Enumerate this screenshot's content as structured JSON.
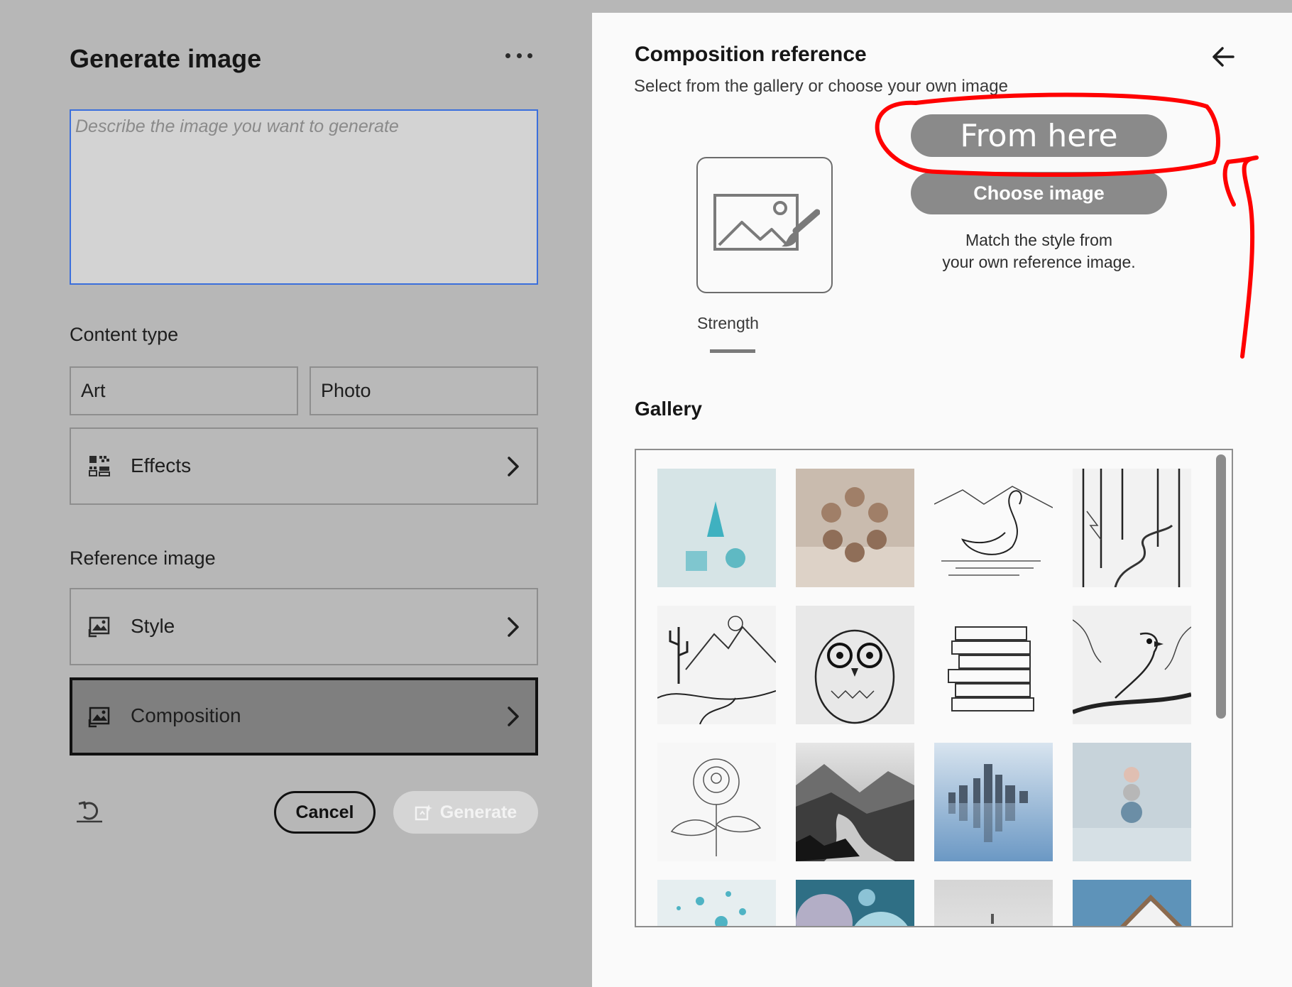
{
  "left_panel": {
    "title": "Generate image",
    "prompt_placeholder": "Describe the image you want to generate",
    "content_type": {
      "label": "Content type",
      "options": [
        "Art",
        "Photo"
      ]
    },
    "effects_label": "Effects",
    "reference_image": {
      "label": "Reference image",
      "style_label": "Style",
      "composition_label": "Composition",
      "active": "Composition"
    },
    "cancel_label": "Cancel",
    "generate_label": "Generate"
  },
  "right_panel": {
    "title": "Composition reference",
    "subtitle": "Select from the gallery or choose your own image",
    "strength_label": "Strength",
    "annotation_label": "From here",
    "choose_image_label": "Choose image",
    "match_text_line1": "Match the style from",
    "match_text_line2": "your own reference image.",
    "gallery_label": "Gallery",
    "gallery_items": [
      "cone-cube-sphere",
      "floating-spheres",
      "swan-line-art",
      "forest-line-art",
      "desert-line-art",
      "owl-line-art",
      "books-line-art",
      "bird-line-art",
      "rose-line-art",
      "misty-mountains",
      "city-skyline-reflection",
      "stacked-spheres",
      "molecules",
      "planets",
      "foggy-landscape",
      "house-roof"
    ]
  },
  "colors": {
    "prompt_border": "#3b6fdc",
    "annotation_red": "#ff0000",
    "pill_gray": "#8a8a8a"
  }
}
